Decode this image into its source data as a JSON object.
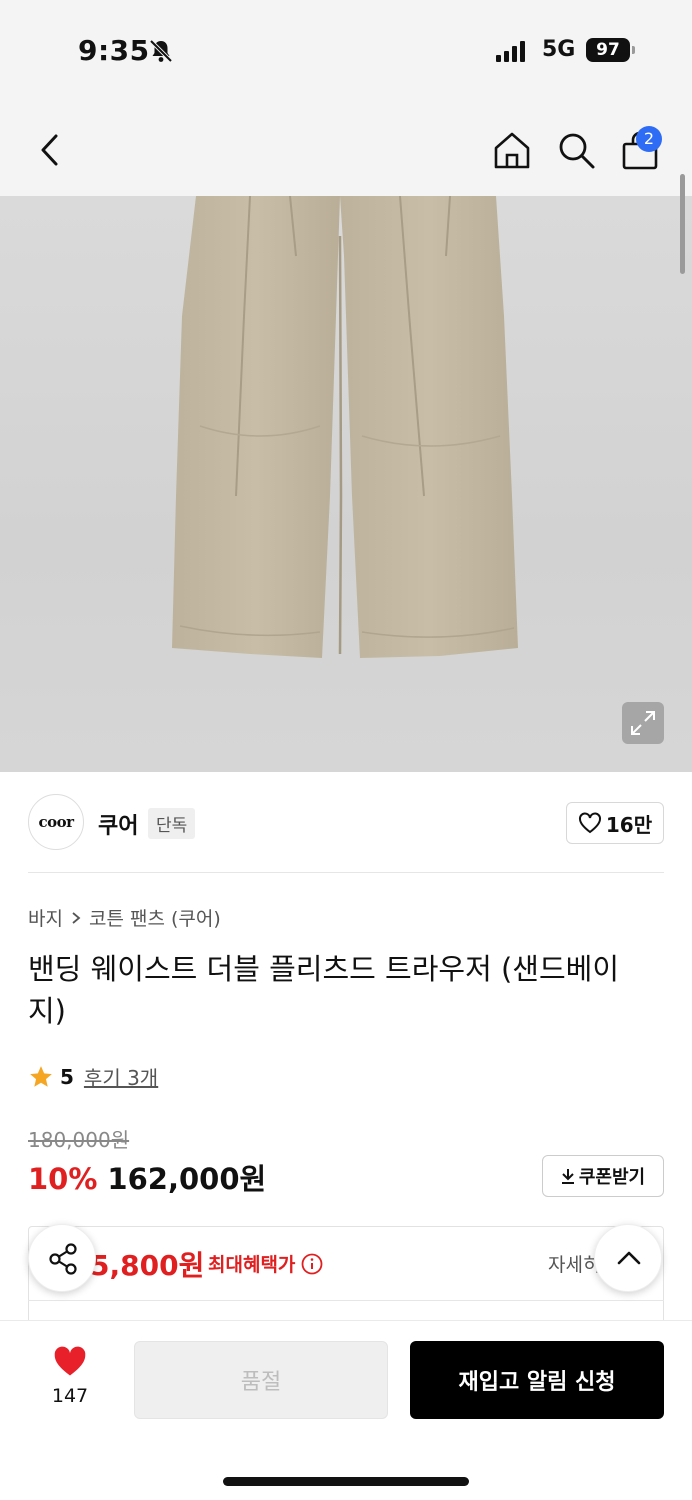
{
  "status_bar": {
    "time": "9:35",
    "network": "5G",
    "battery": "97"
  },
  "nav": {
    "cart_count": "2"
  },
  "brand": {
    "logo_text": "coor",
    "name": "쿠어",
    "tag": "단독",
    "likes": "16만"
  },
  "breadcrumb": {
    "category": "바지",
    "sub": "코튼 팬츠 (쿠어)"
  },
  "product": {
    "title": "밴딩 웨이스트 더블 플리츠드 트라우저 (샌드베이지)",
    "rating": "5",
    "reviews": "후기 3개",
    "original_price": "180,000원",
    "discount": "10%",
    "price": "162,000원",
    "coupon_label": "쿠폰받기"
  },
  "benefit": {
    "price": "5,800원",
    "label": "최대혜택가",
    "detail": "자세히"
  },
  "bottom_bar": {
    "wish_count": "147",
    "soldout_label": "품절",
    "restock_label": "재입고 알림 신청"
  },
  "colors": {
    "accent_red": "#e02020",
    "badge_blue": "#2f6cf6"
  }
}
